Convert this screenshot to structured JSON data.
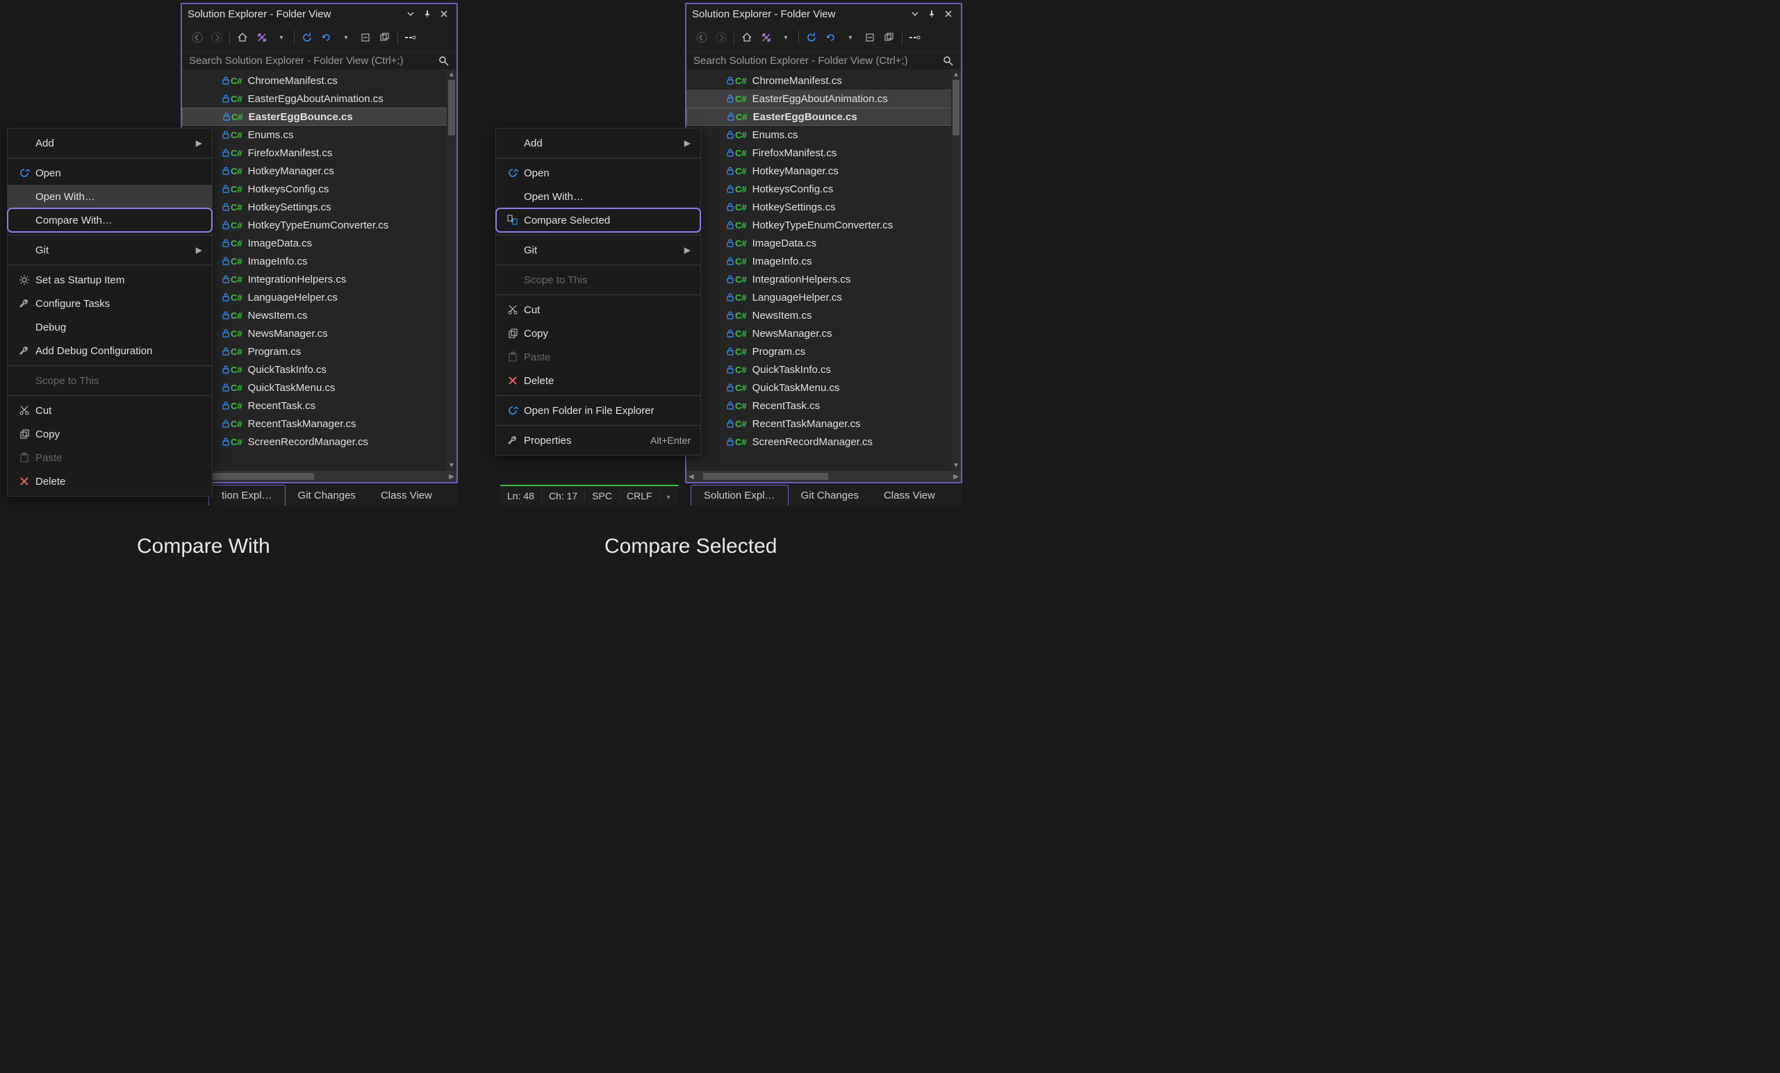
{
  "panel_title": "Solution Explorer - Folder View",
  "search_placeholder": "Search Solution Explorer - Folder View (Ctrl+;)",
  "files": [
    "ChromeManifest.cs",
    "EasterEggAboutAnimation.cs",
    "EasterEggBounce.cs",
    "Enums.cs",
    "FirefoxManifest.cs",
    "HotkeyManager.cs",
    "HotkeysConfig.cs",
    "HotkeySettings.cs",
    "HotkeyTypeEnumConverter.cs",
    "ImageData.cs",
    "ImageInfo.cs",
    "IntegrationHelpers.cs",
    "LanguageHelper.cs",
    "NewsItem.cs",
    "NewsManager.cs",
    "Program.cs",
    "QuickTaskInfo.cs",
    "QuickTaskMenu.cs",
    "RecentTask.cs",
    "RecentTaskManager.cs",
    "ScreenRecordManager.cs"
  ],
  "left": {
    "selected_index": 2,
    "menu": {
      "add": "Add",
      "open": "Open",
      "open_with": "Open With…",
      "compare_with": "Compare With…",
      "git": "Git",
      "set_startup": "Set as Startup Item",
      "configure_tasks": "Configure Tasks",
      "debug": "Debug",
      "add_debug": "Add Debug Configuration",
      "scope": "Scope to This",
      "cut": "Cut",
      "copy": "Copy",
      "paste": "Paste",
      "delete": "Delete"
    },
    "tabs": {
      "active": "tion Expl…",
      "git": "Git Changes",
      "class": "Class View"
    }
  },
  "right": {
    "selected_indices": [
      1,
      2
    ],
    "menu": {
      "add": "Add",
      "open": "Open",
      "open_with": "Open With…",
      "compare_selected": "Compare Selected",
      "git": "Git",
      "scope": "Scope to This",
      "cut": "Cut",
      "copy": "Copy",
      "paste": "Paste",
      "delete": "Delete",
      "open_folder": "Open Folder in File Explorer",
      "properties": "Properties",
      "properties_shortcut": "Alt+Enter"
    },
    "tabs": {
      "active": "Solution Expl…",
      "git": "Git Changes",
      "class": "Class View"
    },
    "status": {
      "ln": "Ln: 48",
      "ch": "Ch: 17",
      "enc": "SPC",
      "eol": "CRLF"
    }
  },
  "captions": {
    "left": "Compare With",
    "right": "Compare Selected"
  }
}
